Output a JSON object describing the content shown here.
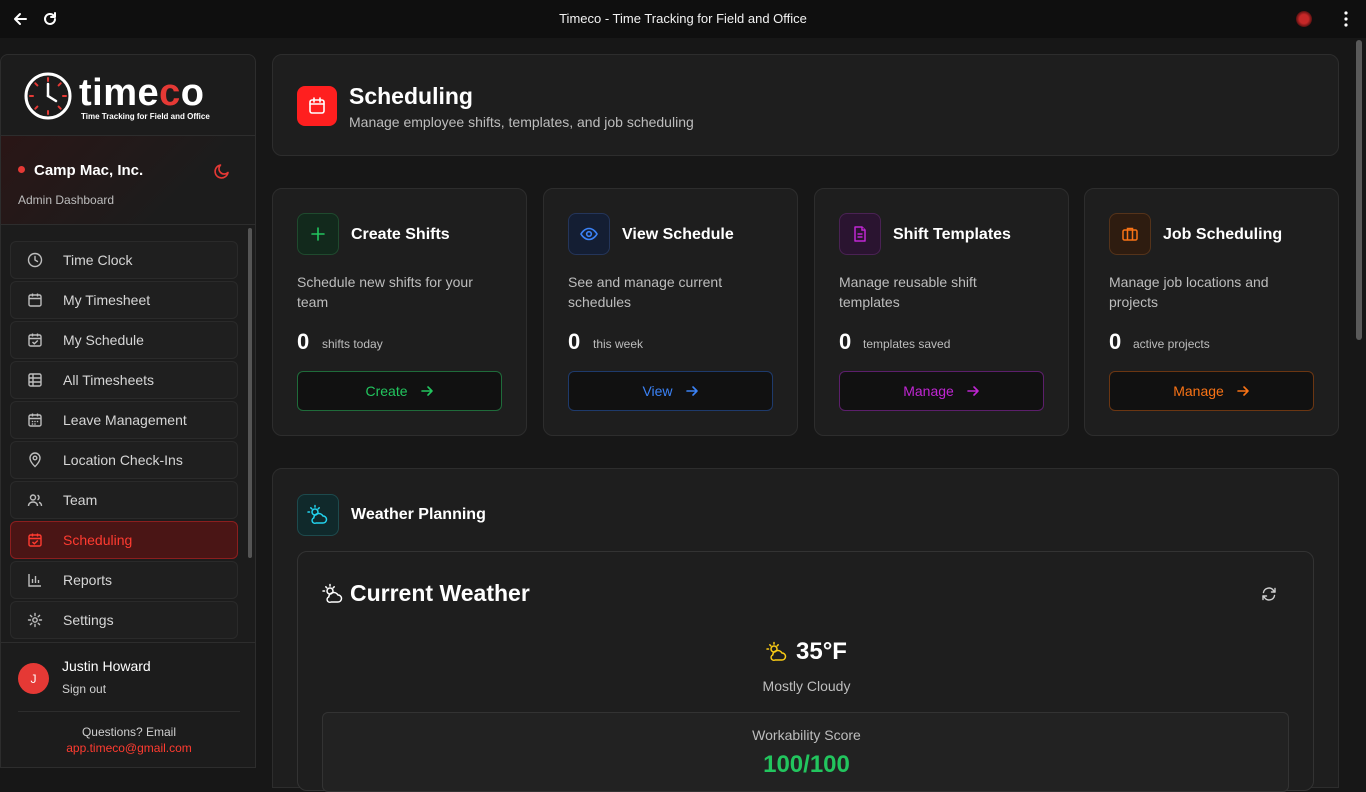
{
  "browser": {
    "title": "Timeco - Time Tracking for Field and Office"
  },
  "sidebar": {
    "logo_pre": "time",
    "logo_red": "c",
    "logo_post": "o",
    "logo_tagline": "Time Tracking for Field and Office",
    "org_name": "Camp Mac, Inc.",
    "org_sub": "Admin Dashboard",
    "items": [
      {
        "label": "Time Clock",
        "icon": "clock-icon"
      },
      {
        "label": "My Timesheet",
        "icon": "calendar-icon"
      },
      {
        "label": "My Schedule",
        "icon": "calendar-check-icon"
      },
      {
        "label": "All Timesheets",
        "icon": "table-icon"
      },
      {
        "label": "Leave Management",
        "icon": "calendar-days-icon"
      },
      {
        "label": "Location Check-Ins",
        "icon": "map-pin-icon"
      },
      {
        "label": "Team",
        "icon": "users-icon"
      },
      {
        "label": "Scheduling",
        "icon": "calendar-check-icon",
        "active": true
      },
      {
        "label": "Reports",
        "icon": "bar-chart-icon"
      },
      {
        "label": "Settings",
        "icon": "gear-icon"
      }
    ],
    "user": {
      "initial": "J",
      "name": "Justin Howard",
      "signout": "Sign out"
    },
    "questions": "Questions? Email",
    "email": "app.timeco@gmail.com"
  },
  "header": {
    "title": "Scheduling",
    "subtitle": "Manage employee shifts, templates, and job scheduling"
  },
  "cards": [
    {
      "title": "Create Shifts",
      "desc": "Schedule new shifts for your team",
      "count": "0",
      "unit": "shifts today",
      "button": "Create",
      "color": "#22c55e"
    },
    {
      "title": "View Schedule",
      "desc": "See and manage current schedules",
      "count": "0",
      "unit": "this week",
      "button": "View",
      "color": "#3b82f6"
    },
    {
      "title": "Shift Templates",
      "desc": "Manage reusable shift templates",
      "count": "0",
      "unit": "templates saved",
      "button": "Manage",
      "color": "#c026d3"
    },
    {
      "title": "Job Scheduling",
      "desc": "Manage job locations and projects",
      "count": "0",
      "unit": "active projects",
      "button": "Manage",
      "color": "#f97316"
    }
  ],
  "weather": {
    "section_title": "Weather Planning",
    "current_title": "Current Weather",
    "temperature": "35°F",
    "condition": "Mostly Cloudy",
    "workability_label": "Workability Score",
    "workability_score": "100/100"
  },
  "colors": {
    "accent": "#e53935",
    "background": "#171717",
    "card": "#1e1e1e"
  }
}
